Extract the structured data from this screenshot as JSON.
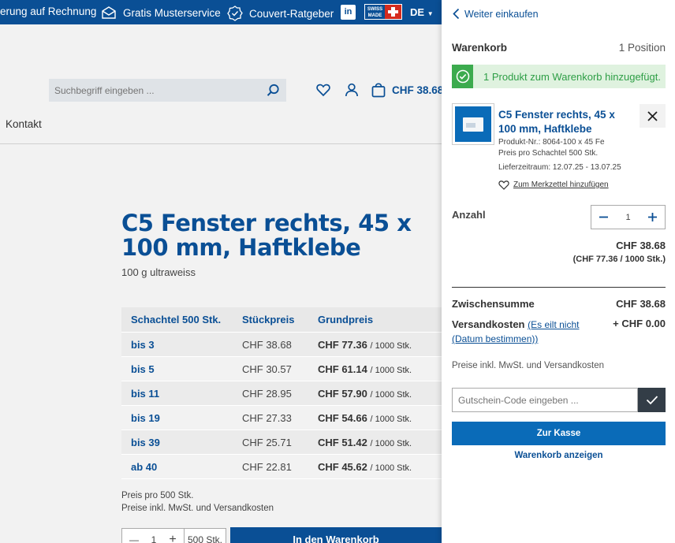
{
  "topbar": {
    "invoice": "erung auf Rechnung",
    "samples": "Gratis Musterservice",
    "guide": "Couvert-Ratgeber",
    "linkedin": "in",
    "swiss_made": "SWISS MADE",
    "language": "DE"
  },
  "header": {
    "search_placeholder": "Suchbegriff eingeben ...",
    "cart_total": "CHF 38.68",
    "nav_contact": "Kontakt"
  },
  "product": {
    "title": "C5 Fenster rechts, 45 x 100 mm, Haftklebe",
    "subtitle": "100 g ultraweiss",
    "table_headers": [
      "Schachtel 500 Stk.",
      "Stückpreis",
      "Grundpreis"
    ],
    "rows": [
      {
        "qty": "bis 3",
        "unit": "CHF 38.68",
        "base": "CHF 77.36",
        "per": "/ 1000 Stk."
      },
      {
        "qty": "bis 5",
        "unit": "CHF 30.57",
        "base": "CHF 61.14",
        "per": "/ 1000 Stk."
      },
      {
        "qty": "bis 11",
        "unit": "CHF 28.95",
        "base": "CHF 57.90",
        "per": "/ 1000 Stk."
      },
      {
        "qty": "bis 19",
        "unit": "CHF 27.33",
        "base": "CHF 54.66",
        "per": "/ 1000 Stk."
      },
      {
        "qty": "bis 39",
        "unit": "CHF 25.71",
        "base": "CHF 51.42",
        "per": "/ 1000 Stk."
      },
      {
        "qty": "ab 40",
        "unit": "CHF 22.81",
        "base": "CHF 45.62",
        "per": "/ 1000 Stk."
      }
    ],
    "note1": "Preis pro 500 Stk.",
    "note2": "Preise inkl. MwSt. und Versandkosten",
    "qty": "1",
    "qty_unit": "500 Stk.",
    "add_to_cart": "In den Warenkorb"
  },
  "panel": {
    "back": "Weiter einkaufen",
    "title": "Warenkorb",
    "count": "1 Position",
    "success": "1 Produkt zum Warenkorb hinzugefügt.",
    "item_name": "C5 Fenster rechts, 45 x 100 mm, Haftklebe",
    "item_sku": "Produkt-Nr.: 8064-100 x 45 Fe",
    "item_pack": "Preis pro Schachtel 500 Stk.",
    "item_delivery": "Lieferzeitraum: 12.07.25 - 13.07.25",
    "wishlist": "Zum Merkzettel hinzufügen",
    "qty_label": "Anzahl",
    "qty": "1",
    "line_price": "CHF 38.68",
    "line_unit": "(CHF 77.36 / 1000 Stk.)",
    "subtotal_label": "Zwischensumme",
    "subtotal": "CHF 38.68",
    "shipping_label": "Versandkosten",
    "shipping_link": "(Es eilt nicht (Datum bestimmen))",
    "shipping": "+ CHF 0.00",
    "vat_note": "Preise inkl. MwSt. und Versandkosten",
    "coupon_placeholder": "Gutschein-Code eingeben ...",
    "checkout": "Zur Kasse",
    "show_cart": "Warenkorb anzeigen"
  },
  "colors": {
    "brand": "#0a4f95",
    "button": "#0a6bb8",
    "success": "#3cab4e"
  }
}
